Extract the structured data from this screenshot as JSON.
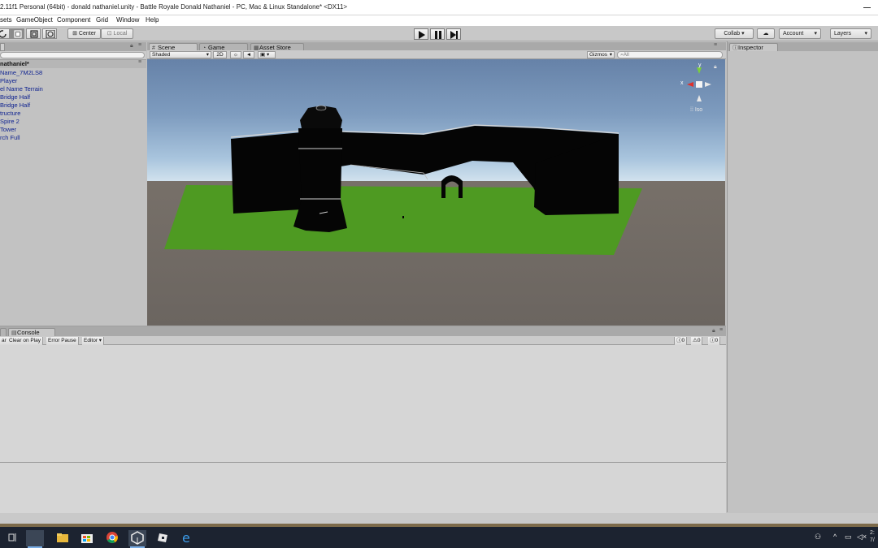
{
  "window": {
    "title": "2.11f1 Personal (64bit) - donald nathaniel.unity - Battle Royale Donald Nathaniel - PC, Mac & Linux Standalone* <DX11>"
  },
  "menu": [
    "sets",
    "GameObject",
    "Component",
    "Grid",
    "Window",
    "Help"
  ],
  "toolbar": {
    "pivot_label": "Center",
    "space_label": "Local",
    "collab_label": "Collab ▾",
    "account_label": "Account",
    "layers_label": "Layers"
  },
  "hierarchy": {
    "scene_name": "nathaniel*",
    "items": [
      "Name_7M2LS8",
      "Player",
      "el Name Terrain",
      "Bridge Half",
      "Bridge Half",
      "tructure",
      "Spire 2",
      "Tower",
      "rch Full"
    ]
  },
  "scene_tabs": {
    "scene": "Scene",
    "game": "Game",
    "asset_store": "Asset Store"
  },
  "scene_toolbar": {
    "shading": "Shaded",
    "mode_2d": "2D",
    "gizmos": "Gizmos",
    "search_placeholder": "All"
  },
  "gizmo": {
    "y_label": "y",
    "x_label": "x",
    "persp_label": "Iso"
  },
  "console": {
    "tab": "Console",
    "clear_partial": "ar",
    "clear_on_play": "Clear on Play",
    "error_pause": "Error Pause",
    "editor": "Editor",
    "log_count": "0",
    "warning_count": "0",
    "error_count": "0"
  },
  "inspector": {
    "tab": "Inspector"
  },
  "clock": {
    "time": "2:",
    "date": "7/"
  },
  "colors": {
    "ui_gray": "#c2c2c2",
    "hierarchy_text": "#0b1f8f",
    "ground_green": "#4e9a22",
    "taskbar": "#1c2330"
  }
}
